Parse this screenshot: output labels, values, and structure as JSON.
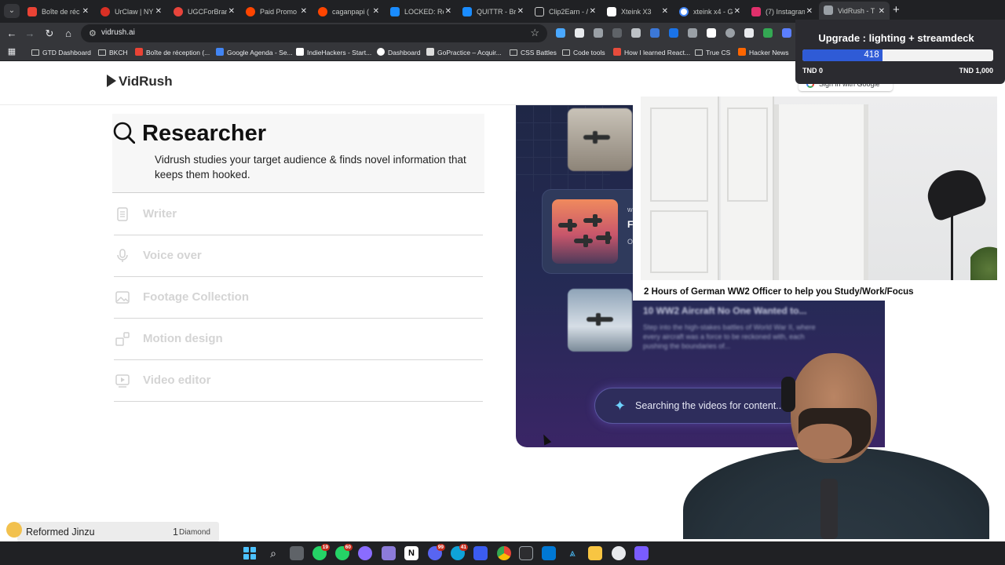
{
  "browser": {
    "tabs": [
      {
        "title": "Boîte de réc",
        "favicon": "gmail-icon",
        "color": "#ea4335"
      },
      {
        "title": "UrClaw | NY",
        "favicon": "urclaw-icon",
        "color": "#d93025"
      },
      {
        "title": "UGCForBran",
        "favicon": "ugc-icon",
        "color": "#e8443b"
      },
      {
        "title": "Paid Promo",
        "favicon": "reddit-icon",
        "color": "#ff4500"
      },
      {
        "title": "caganpapi (",
        "favicon": "reddit-icon",
        "color": "#ff4500"
      },
      {
        "title": "LOCKED: Re",
        "favicon": "appstore-icon",
        "color": "#1a8cff"
      },
      {
        "title": "QUITTR - Br",
        "favicon": "appstore-icon",
        "color": "#1a8cff"
      },
      {
        "title": "Clip2Earn - /",
        "favicon": "clip2earn-icon",
        "color": "#eeeeee"
      },
      {
        "title": "Xteink X3",
        "favicon": "x-icon",
        "color": "#ffffff"
      },
      {
        "title": "xteink x4 - G",
        "favicon": "google-icon",
        "color": "#4285f4"
      },
      {
        "title": "(7) Instagram",
        "favicon": "instagram-icon",
        "color": "#e1306c"
      },
      {
        "title": "VidRush - T",
        "favicon": "vidrush-icon",
        "color": "#9aa0a6"
      }
    ],
    "active_tab_index": 11,
    "url": "vidrush.ai",
    "bookmarks": [
      {
        "label": "GTD Dashboard",
        "type": "folder"
      },
      {
        "label": "BKCH",
        "type": "folder"
      },
      {
        "label": "Boîte de réception (...",
        "type": "site",
        "color": "#ea4335"
      },
      {
        "label": "Google Agenda - Se...",
        "type": "site",
        "color": "#4285f4"
      },
      {
        "label": "IndieHackers - Start...",
        "type": "site",
        "color": "#ffffff"
      },
      {
        "label": "Dashboard",
        "type": "site",
        "color": "#ffffff"
      },
      {
        "label": "GoPractice – Acquir...",
        "type": "site",
        "color": "#dddddd"
      },
      {
        "label": "CSS Battles",
        "type": "folder"
      },
      {
        "label": "Code tools",
        "type": "folder"
      },
      {
        "label": "How I learned React...",
        "type": "site",
        "color": "#e74c3c"
      },
      {
        "label": "True CS",
        "type": "folder"
      },
      {
        "label": "Hacker News",
        "type": "site",
        "color": "#ff6600"
      }
    ]
  },
  "site": {
    "logo": "VidRush",
    "researcher": {
      "title": "Researcher",
      "description": "Vidrush studies your target audience & finds novel information that keeps them hooked."
    },
    "steps": [
      {
        "label": "Writer",
        "icon": "document-icon"
      },
      {
        "label": "Voice over",
        "icon": "microphone-icon"
      },
      {
        "label": "Footage Collection",
        "icon": "image-icon"
      },
      {
        "label": "Motion design",
        "icon": "motion-icon"
      },
      {
        "label": "Video editor",
        "icon": "video-icon"
      }
    ],
    "demo": {
      "card_small": "w",
      "card_big": "F",
      "card_desc": "O jc",
      "video_title": "10 WW2 Aircraft No One Wanted to...",
      "video_desc": "Step into the high-stakes battles of World War II, where every aircraft was a force to be reckoned with, each pushing the boundaries of...",
      "search_text": "Searching the videos for content..",
      "accent": "#6fd3ff"
    },
    "google_signin": "Sign in with Google"
  },
  "overlays": {
    "video_title": "2 Hours of German WW2 Officer to help you Study/Work/Focus",
    "donation": {
      "title": "Upgrade : lighting + streamdeck",
      "amount": "418",
      "progress": 0.418,
      "min_label": "TND 0",
      "max_label": "TND 1,000",
      "bar_color": "#2f5bd6"
    },
    "alert": {
      "name": "Reformed Jinzu",
      "count": "1",
      "unit": "Diamond"
    }
  },
  "taskbar": {
    "badges": {
      "whatsapp": "19",
      "whatsapp2": "60",
      "discord": "99",
      "messenger": "41"
    }
  }
}
